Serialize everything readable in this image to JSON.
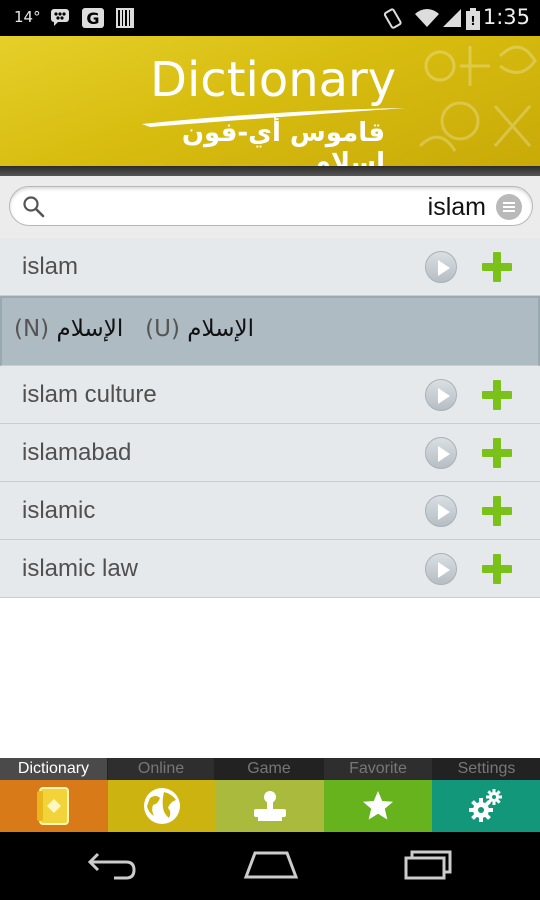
{
  "status_bar": {
    "temperature": "14°",
    "time": "1:35",
    "icons": [
      "bbm-icon",
      "google-icon",
      "barcode-icon",
      "rotate-icon",
      "wifi-icon",
      "signal-icon",
      "battery-icon"
    ]
  },
  "header": {
    "title": "Dictionary",
    "subtitle": "قاموس أي-فون إسلام"
  },
  "search": {
    "value": "islam",
    "placeholder": ""
  },
  "results": [
    {
      "word": "islam"
    },
    {
      "word": "islam culture"
    },
    {
      "word": "islamabad"
    },
    {
      "word": "islamic"
    },
    {
      "word": "islamic law"
    }
  ],
  "definition": {
    "pos_n": "(N)",
    "arabic_n": "الإسلام",
    "pos_u": "(U)",
    "arabic_u": "الإسلام"
  },
  "tabs": [
    {
      "label": "Dictionary",
      "color": "#d87a17",
      "active": true
    },
    {
      "label": "Online",
      "color": "#ccb310",
      "active": false
    },
    {
      "label": "Game",
      "color": "#a9ba3d",
      "active": false
    },
    {
      "label": "Favorite",
      "color": "#66b31d",
      "active": false
    },
    {
      "label": "Settings",
      "color": "#12977a",
      "active": false
    }
  ],
  "colors": {
    "header": "#d8bd10",
    "add": "#7ac21a",
    "selected_row": "#aebbc2"
  }
}
